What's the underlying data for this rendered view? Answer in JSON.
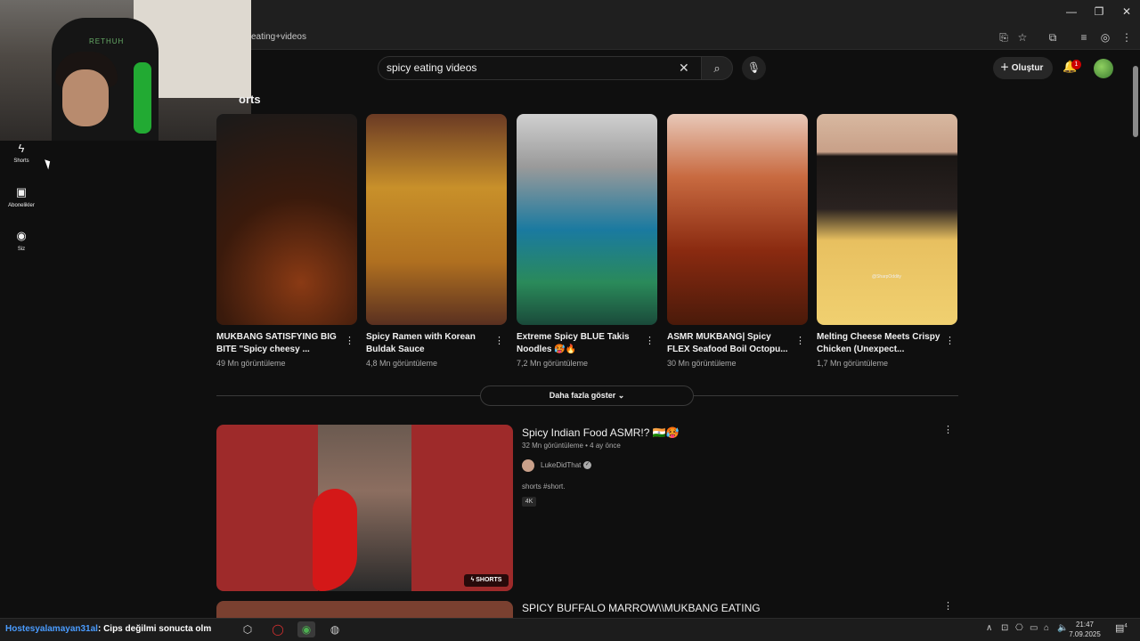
{
  "browser": {
    "url": "eating+videos",
    "window_controls": {
      "minimize": "—",
      "restore": "❐",
      "close": "✕"
    }
  },
  "header": {
    "search_value": "spicy eating videos",
    "create_label": "Oluştur",
    "notification_count": "1"
  },
  "sidebar": {
    "items": [
      {
        "label": "Shorts",
        "icon": "shorts-icon"
      },
      {
        "label": "Abonelikler",
        "icon": "subscriptions-icon"
      },
      {
        "label": "Siz",
        "icon": "you-icon"
      }
    ]
  },
  "shorts": {
    "section_title": "orts",
    "items": [
      {
        "title": "MUKBANG SATISFYING BIG BITE \"Spicy cheesy ...",
        "views": "49 Mn görüntüleme",
        "thumb_color": "#2a1a12"
      },
      {
        "title": "Spicy Ramen with Korean Buldak Sauce",
        "views": "4,8 Mn görüntüleme",
        "thumb_color": "#b0782a"
      },
      {
        "title": "Extreme Spicy BLUE Takis Noodles 🥵🔥",
        "views": "7,2 Mn görüntüleme",
        "thumb_color": "#1a6a8a"
      },
      {
        "title": "ASMR MUKBANG| Spicy FLEX Seafood Boil Octopu...",
        "views": "30 Mn görüntüleme",
        "thumb_color": "#7a2a12"
      },
      {
        "title": "Melting Cheese Meets Crispy Chicken (Unexpect...",
        "views": "1,7 Mn görüntüleme",
        "thumb_color": "#d8b060"
      }
    ],
    "more_label": "Daha fazla göster",
    "watermark": "@SharpOddity"
  },
  "videos": [
    {
      "title": "Spicy Indian Food ASMR!? 🇮🇳🥵",
      "meta": "32 Mn görüntüleme • 4 ay önce",
      "channel": "LukeDidThat",
      "description": "shorts #short.",
      "badge": "4K",
      "overlay_badge": "SHORTS"
    },
    {
      "title": "SPICY BUFFALO MARROW\\\\MUKBANG EATING"
    }
  ],
  "webcam": {
    "shirt_text": "RETHUH"
  },
  "stream_chat": {
    "user": "Hostesyalamayan31al",
    "message": ": Cips değilmi sonucta olm"
  },
  "taskbar": {
    "time": "21:47",
    "date": "7.09.2025",
    "notification_count": "4"
  },
  "colors": {
    "accent": "#cc0000",
    "background": "#0f0f0f",
    "text": "#f1f1f1",
    "secondary_text": "#aaaaaa"
  }
}
